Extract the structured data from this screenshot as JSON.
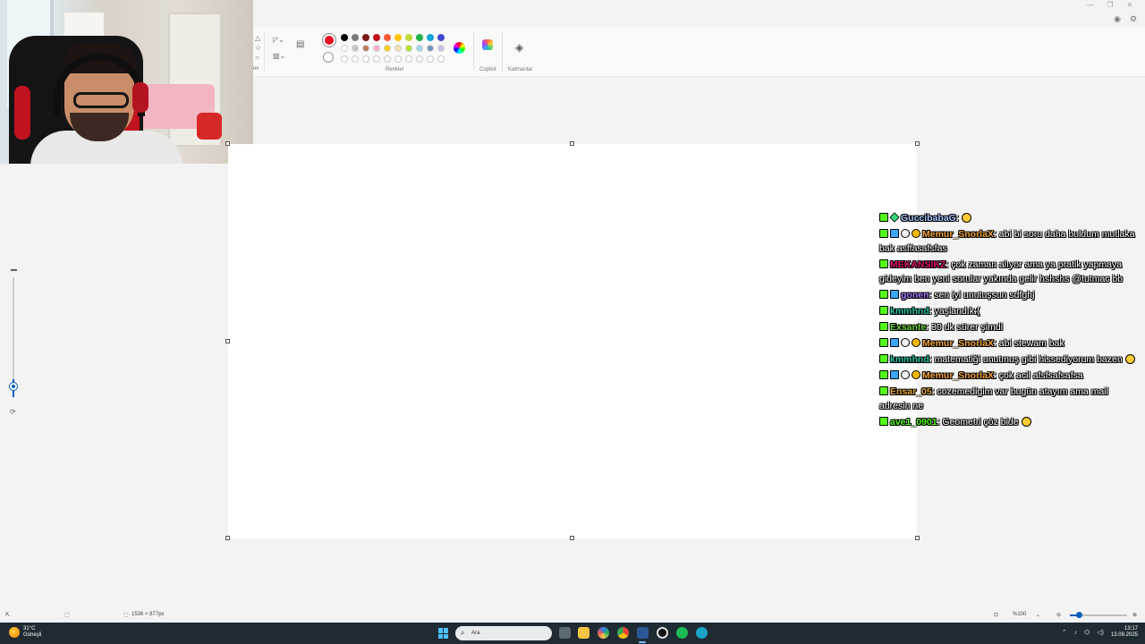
{
  "ribbon": {
    "partial_tool_label": "ler",
    "colors_label": "Renkler",
    "copilot_label": "Copilot",
    "layers_label": "Katmanlar",
    "active_color": "#e81123",
    "swatches_row1": [
      "#000000",
      "#7a7a7a",
      "#7a1616",
      "#c1121f",
      "#ff5a36",
      "#ffc400",
      "#c2d836",
      "#22b14c",
      "#12a3d8",
      "#3f48cc",
      "#a349a4"
    ],
    "swatches_row2": [
      "#ffffff",
      "#c3c3c3",
      "#b97a57",
      "#ffaec9",
      "#ffc90e",
      "#efe4b0",
      "#b5e61d",
      "#99d9ea",
      "#7092be",
      "#c8bfe7"
    ]
  },
  "window_controls": [
    "—",
    "❐",
    "✕"
  ],
  "chat": [
    {
      "user": "GuccibabaG",
      "color": "#a9c6ff",
      "text": ":"
    },
    {
      "user": "Memur_SnorlaX",
      "color": "#f2a53b",
      "text": ": abi bi soru daha buldum mutlaka bak asffasafsfas"
    },
    {
      "user": "MEKANSIKZ",
      "color": "#e0126b",
      "text": ": çok zaman alıyor ama ya pratik yapmaya gideyim ben yeni sorular yakında gelir hshshs @tutmac bb"
    },
    {
      "user": "gonen",
      "color": "#a97bff",
      "text": ": sen iyi unutuşsun sdfghj"
    },
    {
      "user": "kmmhnd",
      "color": "#26c6a6",
      "text": ": yaşlandık:("
    },
    {
      "user": "Exsante",
      "color": "#6ad13a",
      "text": ": 30 dk sürer şimdi"
    },
    {
      "user": "Memur_SnorlaX",
      "color": "#f2a53b",
      "text": ": abi stewam bak"
    },
    {
      "user": "kmmhnd",
      "color": "#26c6a6",
      "text": ": matematiği unutmuş gibi hissediyorum bazen"
    },
    {
      "user": "Memur_SnorlaX",
      "color": "#f2a53b",
      "text": ": çok acil afsfsafsafsa"
    },
    {
      "user": "Ensar_05",
      "color": "#e3a83b",
      "text": ": cozemedigim var bugün atayım ama mail adresin ne"
    },
    {
      "user": "ave1_0901",
      "color": "#53fc18",
      "text": ": Geometri çöz bide"
    }
  ],
  "status": {
    "canvas_size": "1536 × 877px",
    "zoom": "%100"
  },
  "taskbar": {
    "temperature": "31°C",
    "condition": "Güneşli",
    "search_placeholder": "Ara",
    "time": "13:17",
    "date": "13.09.2025"
  }
}
